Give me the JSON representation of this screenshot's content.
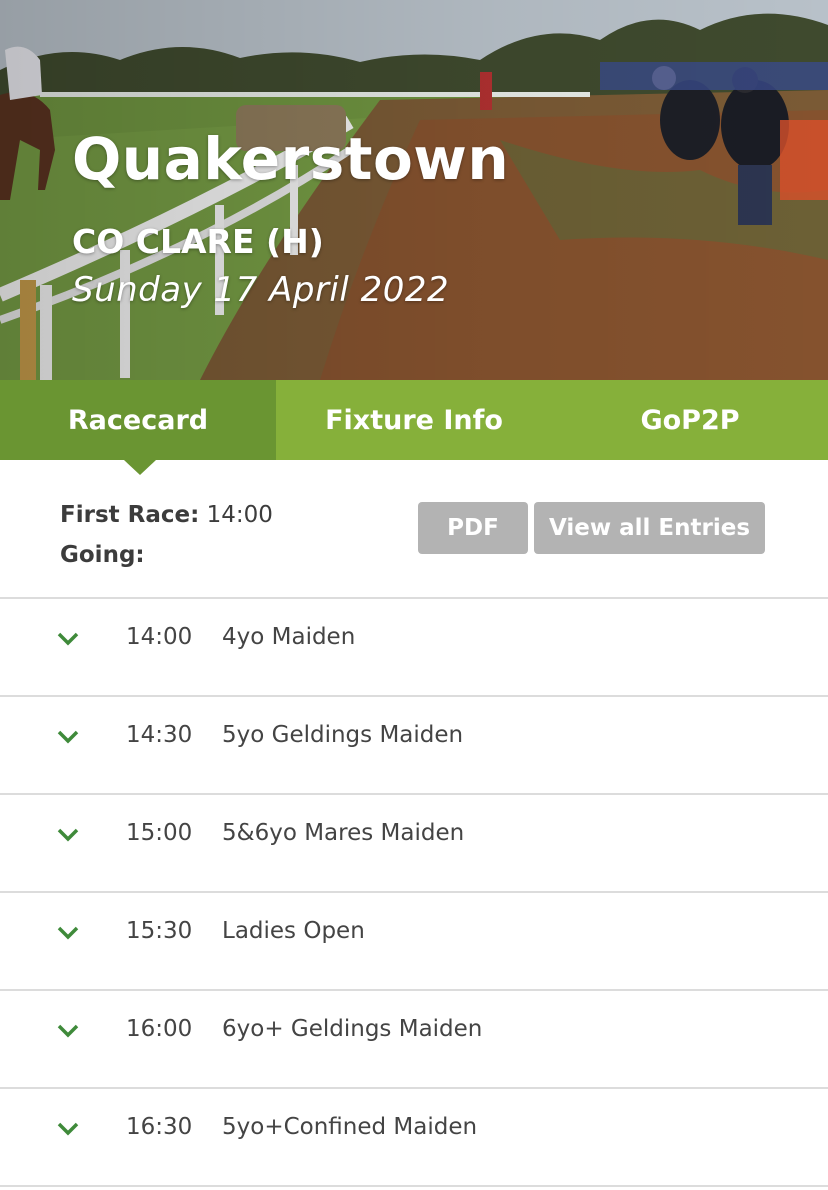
{
  "hero": {
    "venue": "Quakerstown",
    "county": "CO CLARE (H)",
    "date": "Sunday 17 April 2022"
  },
  "tabs": [
    {
      "label": "Racecard",
      "active": true
    },
    {
      "label": "Fixture Info",
      "active": false
    },
    {
      "label": "GoP2P",
      "active": false
    }
  ],
  "info": {
    "first_race_label": "First Race:",
    "first_race_value": "14:00",
    "going_label": "Going:",
    "going_value": "",
    "pdf_label": "PDF",
    "entries_label": "View all Entries"
  },
  "races": [
    {
      "time": "14:00",
      "name": "4yo Maiden"
    },
    {
      "time": "14:30",
      "name": "5yo Geldings Maiden"
    },
    {
      "time": "15:00",
      "name": "5&6yo Mares Maiden"
    },
    {
      "time": "15:30",
      "name": "Ladies Open"
    },
    {
      "time": "16:00",
      "name": "6yo+ Geldings Maiden"
    },
    {
      "time": "16:30",
      "name": "5yo+Confined Maiden"
    }
  ],
  "colors": {
    "tab_bar": "#86b03a",
    "tab_active": "#6a9532",
    "chevron": "#3f8a3a",
    "button_grey": "#b3b3b3"
  },
  "icons": {
    "race_expand": "chevron-down-icon"
  }
}
